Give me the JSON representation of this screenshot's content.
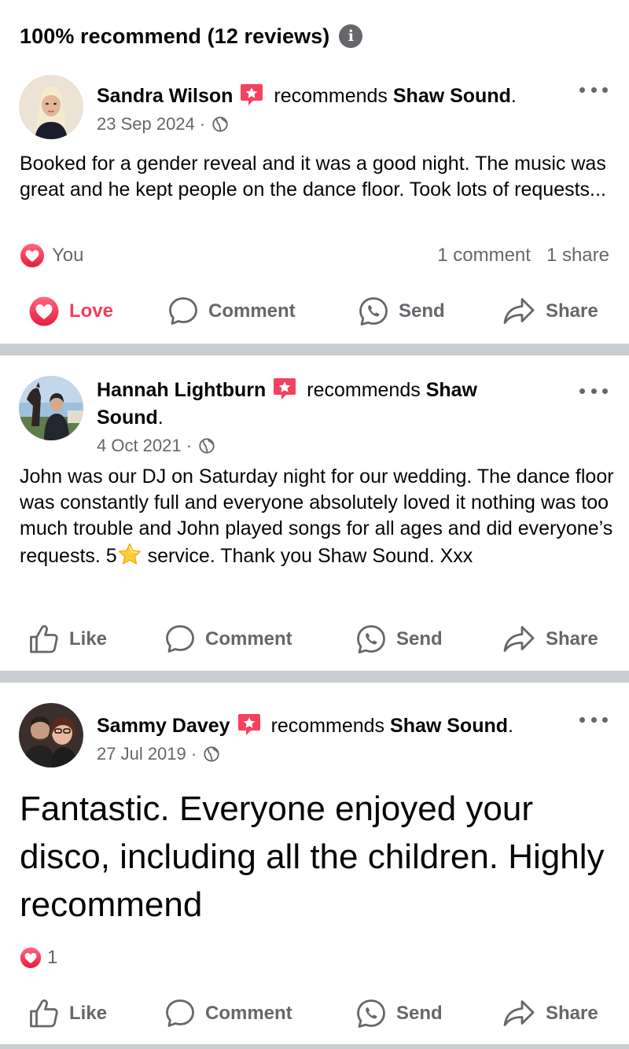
{
  "header": {
    "title": "100% recommend (12 reviews)",
    "info_icon": "i"
  },
  "common": {
    "recommends": "recommends",
    "dot": "·"
  },
  "colors": {
    "love": "#f33e58",
    "muted": "#65676b",
    "divider": "#c9ccd1",
    "badge": "#f3425f"
  },
  "reviews": [
    {
      "author": "Sandra Wilson",
      "page": "Shaw Sound",
      "date": "23 Sep 2024",
      "text": "Booked for a gender reveal and it was a good night.  The music was great and he kept people on the dance floor. Took lots of requests...",
      "reactions": {
        "icon": "heart-icon",
        "label": "You",
        "comments": "1 comment",
        "shares": "1 share"
      },
      "actions": {
        "love": "Love",
        "comment": "Comment",
        "send": "Send",
        "share": "Share"
      }
    },
    {
      "author": "Hannah Lightburn",
      "page": "Shaw",
      "page_cont": "Sound",
      "date": "4 Oct 2021",
      "text_before_star": "John was our DJ on Saturday night for our wedding. The dance floor was constantly full and everyone absolutely loved it nothing was too much trouble and John played songs for all ages and did everyone’s requests. 5",
      "text_after_star": " service. Thank you Shaw Sound. Xxx",
      "actions": {
        "like": "Like",
        "comment": "Comment",
        "send": "Send",
        "share": "Share"
      }
    },
    {
      "author": "Sammy Davey",
      "page": "Shaw Sound",
      "date": "27 Jul 2019",
      "text": "Fantastic. Everyone enjoyed your disco, including all the children. Highly recommend",
      "reactions": {
        "icon": "heart-icon",
        "count": "1"
      },
      "actions": {
        "like": "Like",
        "comment": "Comment",
        "send": "Send",
        "share": "Share"
      }
    }
  ]
}
